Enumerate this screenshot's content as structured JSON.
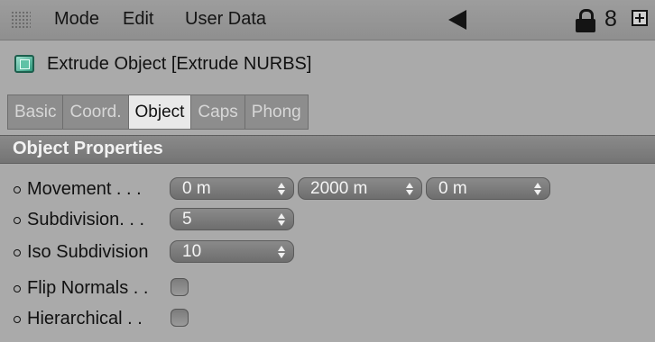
{
  "menubar": {
    "items": [
      "Mode",
      "Edit",
      "User Data"
    ],
    "icons": [
      "grip-icon",
      "back-arrow-icon",
      "lock-icon",
      "eight-icon",
      "plus-icon"
    ],
    "eight_glyph": "8"
  },
  "object": {
    "icon": "extrude-object-icon",
    "title": "Extrude Object [Extrude NURBS]"
  },
  "tabs": [
    {
      "label": "Basic",
      "active": false
    },
    {
      "label": "Coord.",
      "active": false
    },
    {
      "label": "Object",
      "active": true
    },
    {
      "label": "Caps",
      "active": false
    },
    {
      "label": "Phong",
      "active": false
    }
  ],
  "section": {
    "title": "Object Properties"
  },
  "properties": {
    "movement": {
      "label": "Movement . . .",
      "values": [
        "0 m",
        "2000 m",
        "0 m"
      ]
    },
    "subdivision": {
      "label": "Subdivision. . .",
      "value": "5"
    },
    "iso_subdivision": {
      "label": "Iso Subdivision",
      "value": "10"
    },
    "flip_normals": {
      "label": "Flip Normals . .",
      "checked": false
    },
    "hierarchical": {
      "label": "Hierarchical . .",
      "checked": false
    }
  },
  "colors": {
    "panel_bg": "#aaaaaa",
    "section_bar": "#7d7d7d",
    "field_bg": "#7a7a7a",
    "active_tab": "#e9e9e9"
  }
}
